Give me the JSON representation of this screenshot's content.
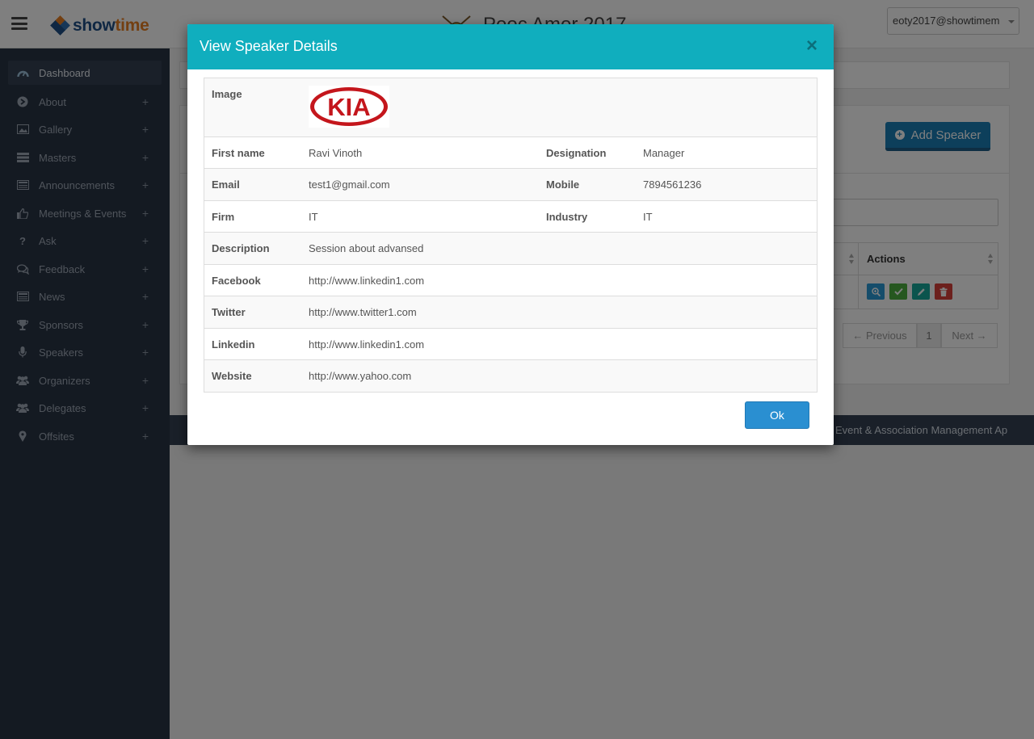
{
  "header": {
    "brand_part1": "show",
    "brand_part2": "time",
    "event_title": "Pooc Amor 2017",
    "user_label": "eoty2017@showtimem"
  },
  "sidebar": {
    "items": [
      {
        "label": "Dashboard",
        "icon": "dashboard-icon"
      },
      {
        "label": "About",
        "icon": "arrow-circle-icon"
      },
      {
        "label": "Gallery",
        "icon": "image-icon"
      },
      {
        "label": "Masters",
        "icon": "list-icon"
      },
      {
        "label": "Announcements",
        "icon": "newspaper-icon"
      },
      {
        "label": "Meetings & Events",
        "icon": "thumbs-up-icon"
      },
      {
        "label": "Ask",
        "icon": "question-icon"
      },
      {
        "label": "Feedback",
        "icon": "comments-icon"
      },
      {
        "label": "News",
        "icon": "newspaper-icon"
      },
      {
        "label": "Sponsors",
        "icon": "trophy-icon"
      },
      {
        "label": "Speakers",
        "icon": "microphone-icon"
      },
      {
        "label": "Organizers",
        "icon": "users-icon"
      },
      {
        "label": "Delegates",
        "icon": "users-icon"
      },
      {
        "label": "Offsites",
        "icon": "map-marker-icon"
      }
    ],
    "expand_symbol": "+"
  },
  "page": {
    "add_button_label": "Add Speaker",
    "actions_header": "Actions",
    "pager_previous": "← Previous",
    "pager_current": "1",
    "pager_next": "Next →",
    "footer_text": "- Event & Association Management Ap"
  },
  "modal": {
    "title": "View Speaker Details",
    "close_symbol": "×",
    "image_label": "Image",
    "logo_text": "KIA",
    "rows": {
      "first_name": {
        "label": "First name",
        "value": "Ravi Vinoth"
      },
      "designation": {
        "label": "Designation",
        "value": "Manager"
      },
      "email": {
        "label": "Email",
        "value": "test1@gmail.com"
      },
      "mobile": {
        "label": "Mobile",
        "value": "7894561236"
      },
      "firm": {
        "label": "Firm",
        "value": "IT"
      },
      "industry": {
        "label": "Industry",
        "value": "IT"
      },
      "description": {
        "label": "Description",
        "value": "Session about advansed"
      },
      "facebook": {
        "label": "Facebook",
        "value": "http://www.linkedin1.com"
      },
      "twitter": {
        "label": "Twitter",
        "value": "http://www.twitter1.com"
      },
      "linkedin": {
        "label": "Linkedin",
        "value": "http://www.linkedin1.com"
      },
      "website": {
        "label": "Website",
        "value": "http://www.yahoo.com"
      }
    },
    "ok_label": "Ok"
  },
  "colors": {
    "modal_header": "#10aebe",
    "sidebar_bg": "#293444",
    "ok_button": "#2a8fd1",
    "logo_red": "#c4161c"
  }
}
